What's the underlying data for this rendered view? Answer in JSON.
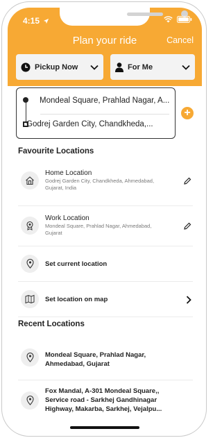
{
  "status_bar": {
    "time": "4:15"
  },
  "header": {
    "title": "Plan your ride",
    "cancel_label": "Cancel"
  },
  "dropdowns": {
    "pickup": {
      "label": "Pickup Now"
    },
    "rider": {
      "label": "For Me"
    }
  },
  "route": {
    "from": "Mondeal Square, Prahlad Nagar, A...",
    "to": "Godrej Garden City, Chandkheda,..."
  },
  "favourites": {
    "title": "Favourite Locations",
    "items": [
      {
        "title": "Home Location",
        "subtitle": "Godrej Garden City, Chandkheda, Ahmedabad, Gujarat, India"
      },
      {
        "title": "Work Location",
        "subtitle": "Mondeal Square, Prahlad Nagar, Ahmedabad, Gujarat"
      },
      {
        "title": "Set current location"
      },
      {
        "title": "Set location on map"
      }
    ]
  },
  "recent": {
    "title": "Recent Locations",
    "items": [
      {
        "text": "Mondeal Square, Prahlad Nagar, Ahmedabad, Gujarat"
      },
      {
        "text": "Fox Mandal, A-301 Mondeal Square,, Service road - Sarkhej Gandhinagar Highway, Makarba, Sarkhej, Vejalpu..."
      }
    ]
  },
  "colors": {
    "accent": "#f7a934",
    "text": "#222222",
    "muted": "#7a7a7a"
  }
}
